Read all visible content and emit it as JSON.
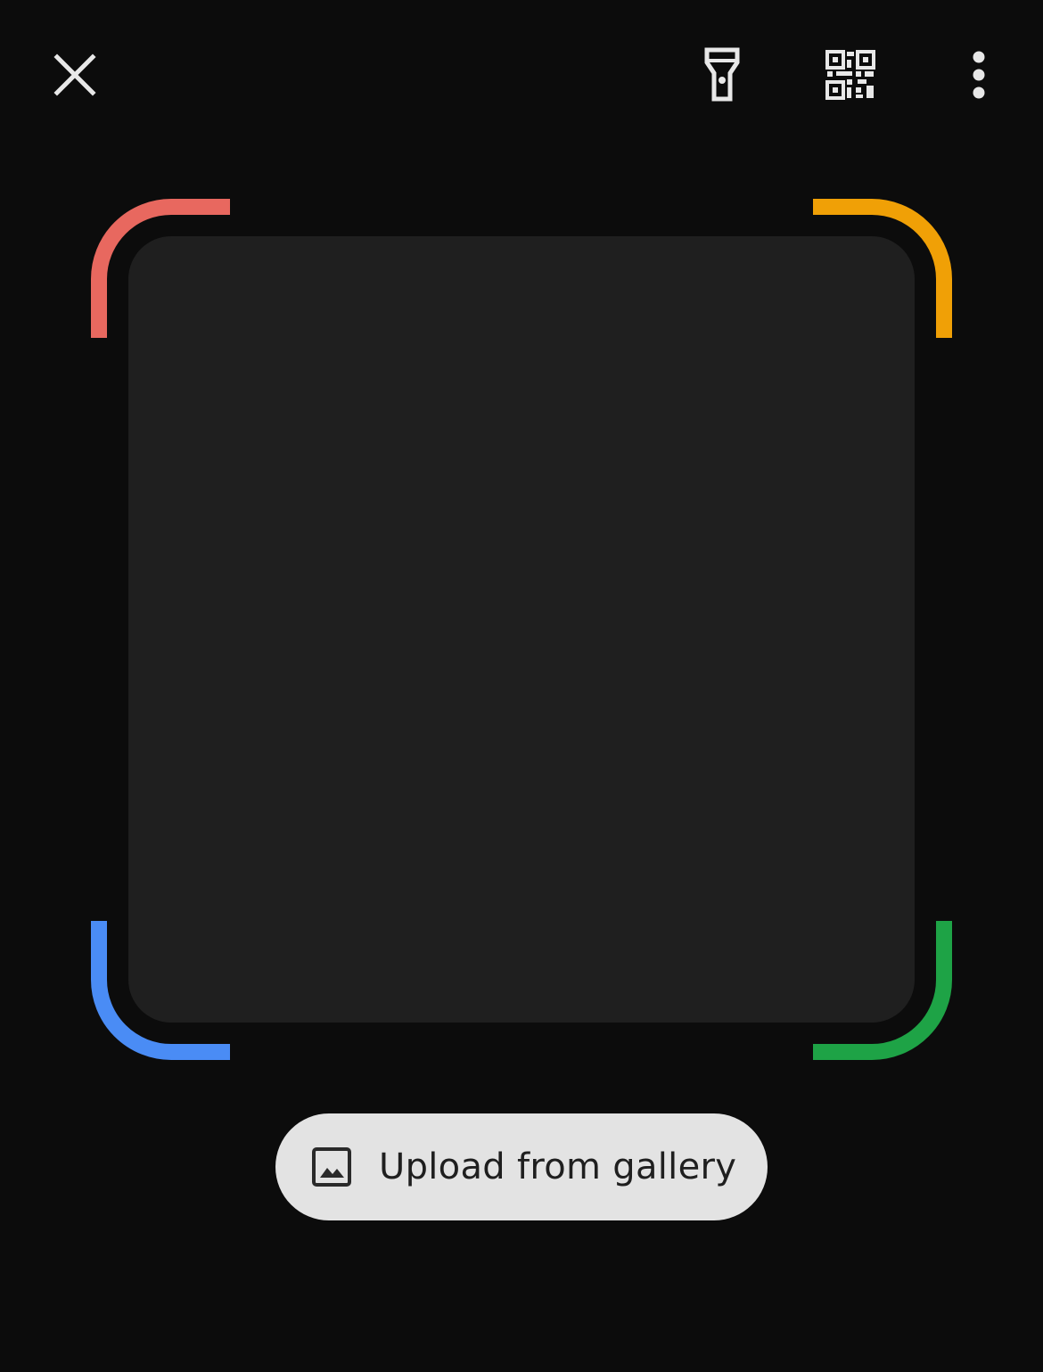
{
  "toolbar": {
    "close_icon": "close-icon",
    "flashlight_icon": "flashlight-icon",
    "qr_icon": "qr-code-icon",
    "more_icon": "more-vertical-icon"
  },
  "scanner": {
    "corner_colors": {
      "top_left": "#e8685f",
      "top_right": "#f0a006",
      "bottom_left": "#4a8cf5",
      "bottom_right": "#1ea346"
    }
  },
  "upload": {
    "label": "Upload from gallery",
    "icon": "image-icon"
  },
  "colors": {
    "background": "#0c0c0c",
    "viewfinder": "#1f1f1f",
    "button_bg": "#e3e3e3",
    "icon": "#e8e8e8"
  }
}
